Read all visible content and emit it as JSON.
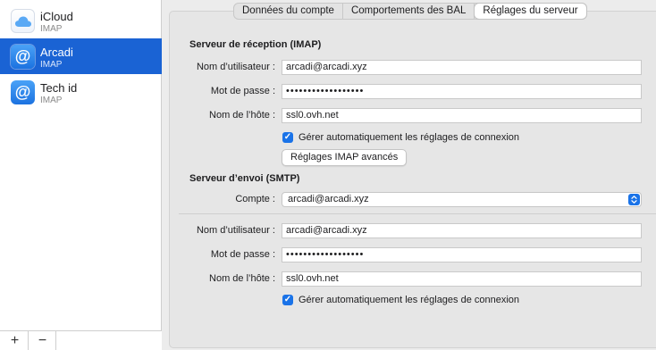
{
  "sidebar": {
    "accounts": [
      {
        "name": "iCloud",
        "type": "IMAP",
        "icon": "icloud-icon",
        "selected": false
      },
      {
        "name": "Arcadi",
        "type": "IMAP",
        "icon": "at-icon",
        "selected": true
      },
      {
        "name": "Tech id",
        "type": "IMAP",
        "icon": "at-icon",
        "selected": false
      }
    ],
    "add_label": "+",
    "remove_label": "−"
  },
  "tabs": [
    {
      "label": "Données du compte",
      "active": false
    },
    {
      "label": "Comportements des BAL",
      "active": false
    },
    {
      "label": "Réglages du serveur",
      "active": true
    }
  ],
  "imap": {
    "section_title": "Serveur de réception (IMAP)",
    "username_label": "Nom d’utilisateur :",
    "username_value": "arcadi@arcadi.xyz",
    "password_label": "Mot de passe :",
    "password_value": "••••••••••••••••••",
    "host_label": "Nom de l’hôte :",
    "host_value": "ssl0.ovh.net",
    "auto_manage_label": "Gérer automatiquement les réglages de connexion",
    "auto_manage_checked": true,
    "advanced_button": "Réglages IMAP avancés"
  },
  "smtp": {
    "section_title": "Serveur d’envoi (SMTP)",
    "account_label": "Compte :",
    "account_value": "arcadi@arcadi.xyz",
    "username_label": "Nom d’utilisateur :",
    "username_value": "arcadi@arcadi.xyz",
    "password_label": "Mot de passe :",
    "password_value": "••••••••••••••••••",
    "host_label": "Nom de l’hôte :",
    "host_value": "ssl0.ovh.net",
    "auto_manage_label": "Gérer automatiquement les réglages de connexion",
    "auto_manage_checked": true
  },
  "colors": {
    "accent": "#1a63d4",
    "checkbox": "#1a73e8"
  }
}
